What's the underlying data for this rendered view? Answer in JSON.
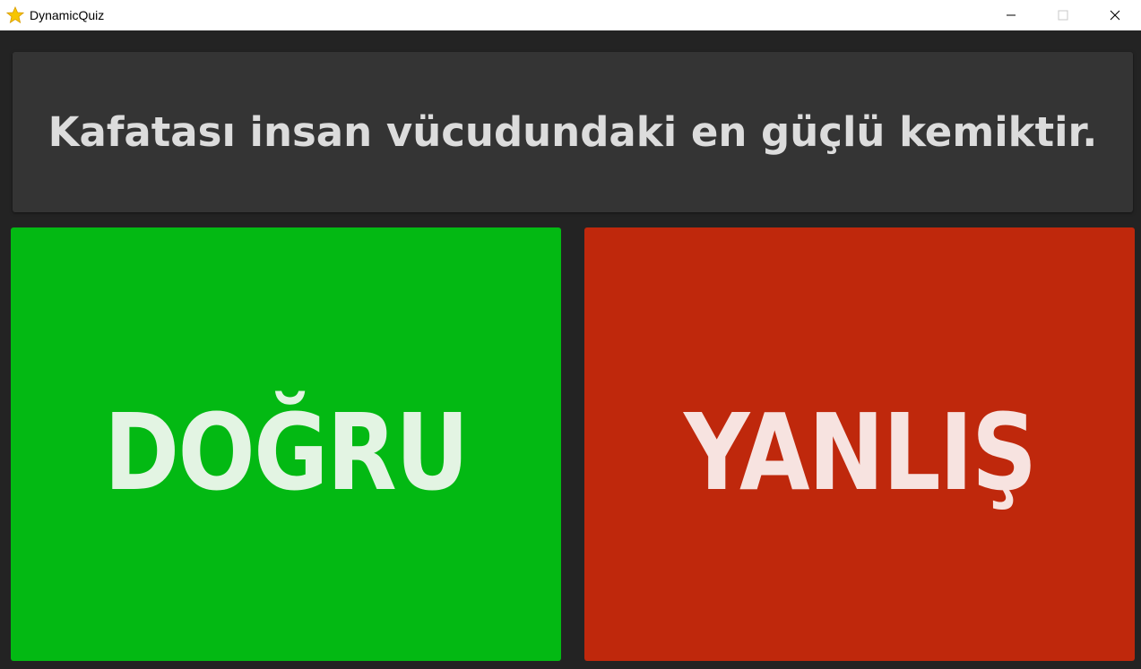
{
  "window": {
    "title": "DynamicQuiz",
    "icon": "star-icon",
    "controls": [
      "minimize-icon",
      "maximize-icon",
      "close-icon"
    ]
  },
  "quiz": {
    "question": "Kafatası insan vücudundaki en güçlü kemiktir.",
    "answers": {
      "true_label": "DOĞRU",
      "false_label": "YANLIŞ"
    }
  },
  "colors": {
    "background": "#232323",
    "question_panel": "#343434",
    "true_button": "#03b913",
    "false_button": "#bf280c"
  }
}
